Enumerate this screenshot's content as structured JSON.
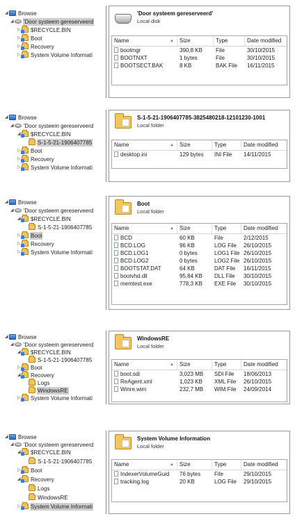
{
  "tree_labels": {
    "browse": "Browse",
    "drive": "'Door systeem gereserveerd'",
    "drive_short": "'Door systeem gereserveerd",
    "recycle": "$RECYCLE.BIN",
    "sid": "S-1-5-21-1906407785",
    "boot": "Boot",
    "recovery": "Recovery",
    "svi": "System Volume Informati",
    "logs": "Logs",
    "winre": "WindowsRE"
  },
  "columns": {
    "name": "Name",
    "size": "Size",
    "type": "Type",
    "date": "Date modified"
  },
  "panels": [
    {
      "title": "'Door systeem gereserveerd'",
      "subtitle": "Local disk",
      "icon": "drive-icon",
      "rows": [
        {
          "name": "bootmgr",
          "size": "390,8 KB",
          "type": "File",
          "date": "30/10/2015"
        },
        {
          "name": "BOOTNXT",
          "size": "1 bytes",
          "type": "File",
          "date": "30/10/2015"
        },
        {
          "name": "BOOTSECT.BAK",
          "size": "8 KB",
          "type": "BAK File",
          "date": "16/11/2015"
        }
      ]
    },
    {
      "title": "S-1-5-21-1906407785-3825480218-12101230-1001",
      "subtitle": "Local folder",
      "icon": "folder-icon",
      "rows": [
        {
          "name": "desktop.ini",
          "size": "129 bytes",
          "type": "INI File",
          "date": "14/11/2015"
        }
      ]
    },
    {
      "title": "Boot",
      "subtitle": "Local folder",
      "icon": "folder-icon",
      "rows": [
        {
          "name": "BCD",
          "size": "60 KB",
          "type": "File",
          "date": "2/12/2015"
        },
        {
          "name": "BCD.LOG",
          "size": "96 KB",
          "type": "LOG File",
          "date": "26/10/2015"
        },
        {
          "name": "BCD.LOG1",
          "size": "0 bytes",
          "type": "LOG1 File",
          "date": "26/10/2015"
        },
        {
          "name": "BCD.LOG2",
          "size": "0 bytes",
          "type": "LOG2 File",
          "date": "26/10/2015"
        },
        {
          "name": "BOOTSTAT.DAT",
          "size": "64 KB",
          "type": "DAT File",
          "date": "16/11/2015"
        },
        {
          "name": "bootvhd.dll",
          "size": "95,84 KB",
          "type": "DLL File",
          "date": "30/10/2015"
        },
        {
          "name": "memtest.exe",
          "size": "778,3 KB",
          "type": "EXE File",
          "date": "30/10/2015"
        }
      ]
    },
    {
      "title": "WindowsRE",
      "subtitle": "Local folder",
      "icon": "folder-icon",
      "rows": [
        {
          "name": "boot.sdi",
          "size": "3,023 MB",
          "type": "SDI File",
          "date": "18/06/2013"
        },
        {
          "name": "ReAgent.xml",
          "size": "1,023 KB",
          "type": "XML File",
          "date": "26/10/2015"
        },
        {
          "name": "Winre.wim",
          "size": "232,7 MB",
          "type": "WIM File",
          "date": "24/09/2014"
        }
      ]
    },
    {
      "title": "System Volume Information",
      "subtitle": "Local folder",
      "icon": "folder-icon",
      "rows": [
        {
          "name": "IndexerVolumeGuid",
          "size": "76 bytes",
          "type": "File",
          "date": "29/10/2015"
        },
        {
          "name": "tracking.log",
          "size": "20 KB",
          "type": "LOG File",
          "date": "29/10/2015"
        }
      ]
    }
  ],
  "colors": {
    "selection": "#cfcfcf",
    "folder": "#f0c45a",
    "library": "#3a7be0",
    "border": "#a8a8a8"
  }
}
